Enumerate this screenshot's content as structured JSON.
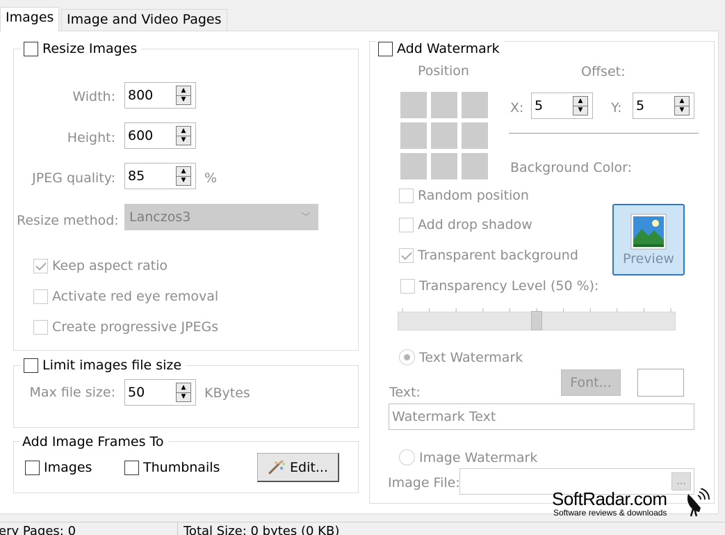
{
  "tabs": [
    "Images",
    "Image and Video Pages"
  ],
  "resize": {
    "title": "Resize Images",
    "width_label": "Width:",
    "width_value": "800",
    "height_label": "Height:",
    "height_value": "600",
    "jpeg_label": "JPEG quality:",
    "jpeg_value": "85",
    "jpeg_unit": "%",
    "method_label": "Resize method:",
    "method_value": "Lanczos3",
    "keep_aspect": "Keep aspect ratio",
    "red_eye": "Activate red eye removal",
    "progressive": "Create progressive JPEGs"
  },
  "limit": {
    "title": "Limit images file size",
    "max_label": "Max file size:",
    "max_value": "50",
    "max_unit": "KBytes"
  },
  "frames": {
    "title": "Add Image Frames To",
    "images": "Images",
    "thumbnails": "Thumbnails",
    "edit": "Edit..."
  },
  "watermark": {
    "title": "Add Watermark",
    "position_label": "Position",
    "offset_label": "Offset:",
    "x_label": "X:",
    "x_value": "5",
    "y_label": "Y:",
    "y_value": "5",
    "bg_color_label": "Background Color:",
    "random": "Random position",
    "shadow": "Add drop shadow",
    "transparent_bg": "Transparent background",
    "transparency_level": "Transparency Level (50 %):",
    "transparency_value": 50,
    "preview": "Preview",
    "text_wm": "Text Watermark",
    "font_btn": "Font...",
    "text_label": "Text:",
    "text_value": "Watermark Text",
    "image_wm": "Image Watermark",
    "image_file_label": "Image File:",
    "browse": "..."
  },
  "status": {
    "pages": "ery Pages: 0",
    "total": "Total Size: 0 bytes (0 KB)"
  },
  "watermark_brand": {
    "name": "SoftRadar.com",
    "tagline": "Software reviews & downloads"
  }
}
